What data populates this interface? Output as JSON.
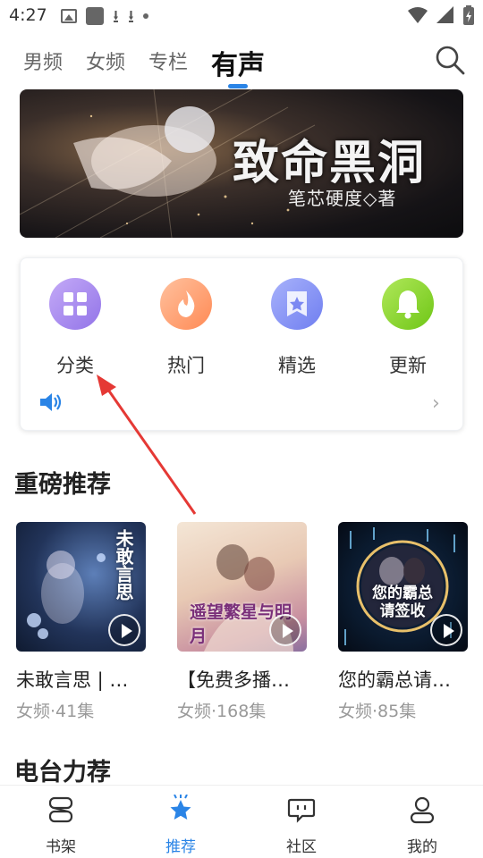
{
  "status_bar": {
    "time": "4:27",
    "icons": [
      "image-icon",
      "app-icon",
      "download-icon",
      "download-icon",
      "dot-icon",
      "wifi-icon",
      "signal-icon",
      "battery-icon"
    ]
  },
  "top_tabs": {
    "items": [
      {
        "label": "男频",
        "active": false
      },
      {
        "label": "女频",
        "active": false
      },
      {
        "label": "专栏",
        "active": false
      },
      {
        "label": "有声",
        "active": true
      }
    ],
    "search_icon": "search-icon"
  },
  "banner": {
    "title": "致命黑洞",
    "subtitle": "笔芯硬度◇著"
  },
  "categories": {
    "items": [
      {
        "label": "分类",
        "icon": "grid-icon",
        "color": "#a98ef0"
      },
      {
        "label": "热门",
        "icon": "flame-icon",
        "color": "#ff9e6e"
      },
      {
        "label": "精选",
        "icon": "star-bookmark-icon",
        "color": "#8b97f5"
      },
      {
        "label": "更新",
        "icon": "bell-icon",
        "color": "#8ed62b"
      }
    ],
    "speaker_icon": "speaker-icon",
    "chevron_icon": "chevron-right-icon"
  },
  "sections": {
    "featured": "重磅推荐",
    "radio": "电台力荐"
  },
  "books": [
    {
      "title": "未敢言思 | …",
      "meta": "女频·41集",
      "cover_text": "未敢言思"
    },
    {
      "title": "【免费多播…",
      "meta": "女频·168集",
      "cover_text": "遥望繁星与明月"
    },
    {
      "title": "您的霸总请…",
      "meta": "女频·85集",
      "cover_text": "您的霸总请签收"
    }
  ],
  "bottom_nav": {
    "items": [
      {
        "label": "书架",
        "icon": "bookshelf-icon",
        "active": false
      },
      {
        "label": "推荐",
        "icon": "star-icon",
        "active": true
      },
      {
        "label": "社区",
        "icon": "chat-icon",
        "active": false
      },
      {
        "label": "我的",
        "icon": "user-icon",
        "active": false
      }
    ]
  },
  "colors": {
    "accent": "#2a84e6",
    "annotation": "#e53935"
  }
}
